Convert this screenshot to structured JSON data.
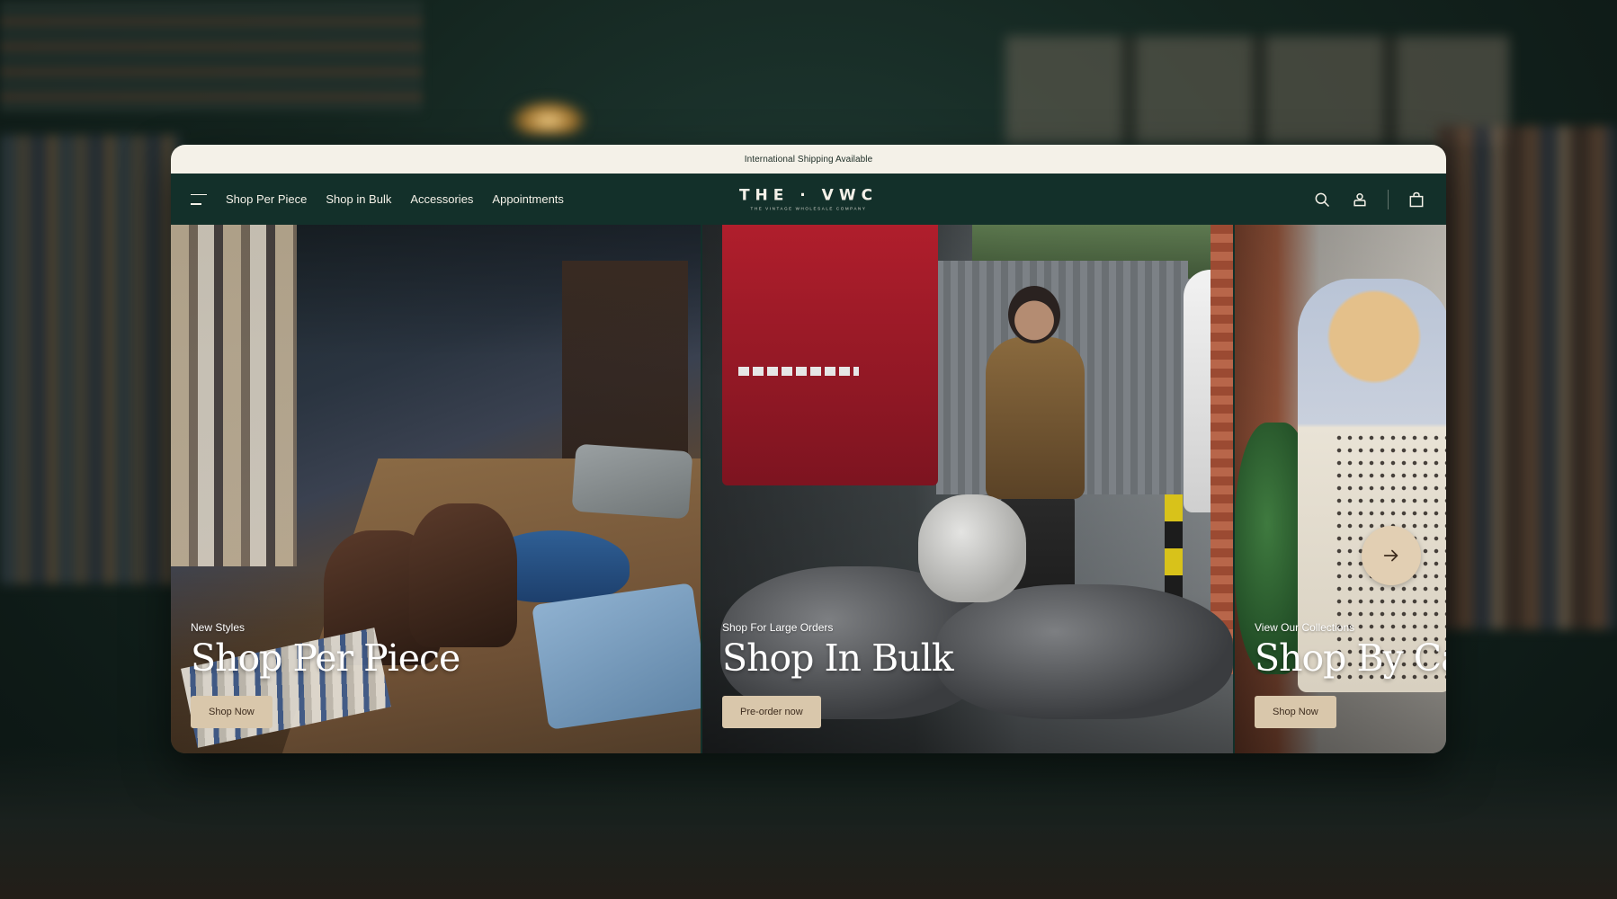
{
  "announcement": {
    "text": "International Shipping Available"
  },
  "nav": {
    "links": [
      "Shop Per Piece",
      "Shop in Bulk",
      "Accessories",
      "Appointments"
    ],
    "logo_main": "THE · VWC",
    "logo_sub": "THE VINTAGE WHOLESALE COMPANY",
    "icons": [
      "menu-icon",
      "search-icon",
      "account-icon",
      "cart-icon"
    ]
  },
  "panels": [
    {
      "eyebrow": "New Styles",
      "title": "Shop Per Piece",
      "cta": "Shop Now"
    },
    {
      "eyebrow": "Shop For Large Orders",
      "title": "Shop In Bulk",
      "cta": "Pre-order now"
    },
    {
      "eyebrow": "View Our Collections",
      "title": "Shop By Ca",
      "cta": "Shop Now"
    }
  ],
  "carousel": {
    "next_icon": "arrow-right-icon"
  },
  "colors": {
    "nav_bg": "#13302a",
    "announcement_bg": "#f4f1e8",
    "cta_bg": "#d9c7ab",
    "arrow_bg": "#e2cfb3"
  }
}
